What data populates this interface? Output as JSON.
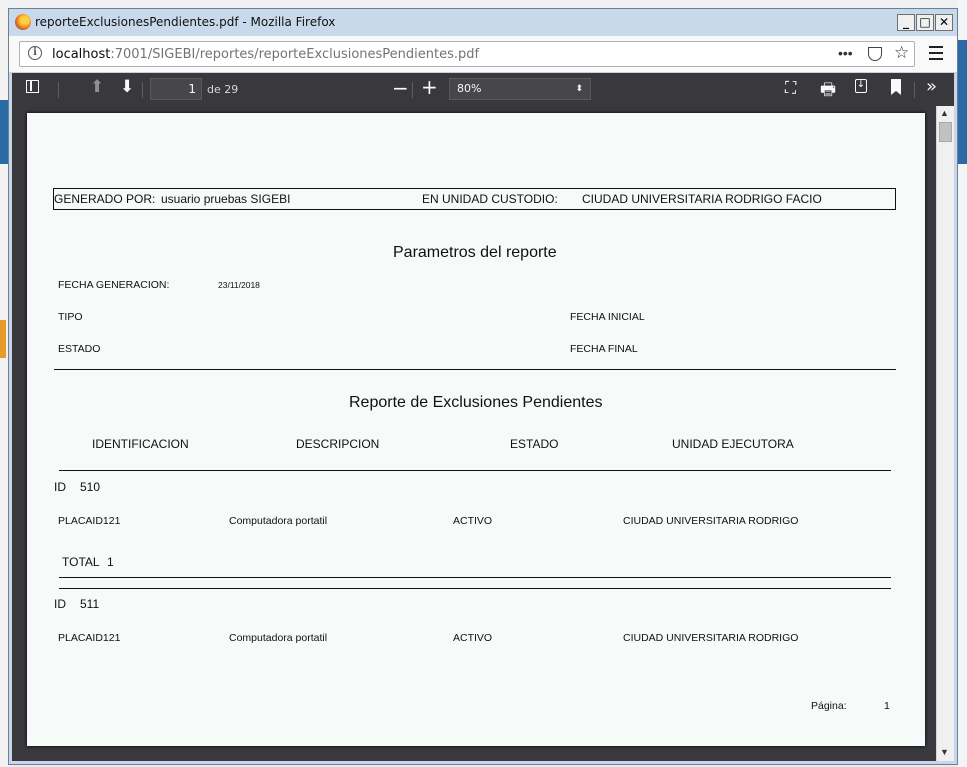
{
  "window": {
    "title": "reporteExclusionesPendientes.pdf - Mozilla Firefox",
    "minimize": "_",
    "maximize": "□",
    "close": "✕"
  },
  "navbar": {
    "url_host": "localhost",
    "url_path": ":7001/SIGEBI/reportes/reporteExclusionesPendientes.pdf",
    "more": "•••"
  },
  "pdf_toolbar": {
    "page_number": "1",
    "page_count_label": "de 29",
    "zoom": "80%"
  },
  "report": {
    "generated_by_label": "GENERADO POR:",
    "generated_by_value": "usuario pruebas SIGEBI",
    "unit_label": "EN UNIDAD CUSTODIO:",
    "unit_value": "CIUDAD UNIVERSITARIA RODRIGO FACIO",
    "params_title": "Parametros del reporte",
    "fecha_generacion_label": "FECHA GENERACION:",
    "fecha_generacion_value": "23/11/2018",
    "tipo_label": "TIPO",
    "fecha_inicial_label": "FECHA INICIAL",
    "estado_label": "ESTADO",
    "fecha_final_label": "FECHA FINAL",
    "report_title": "Reporte de Exclusiones Pendientes",
    "columns": [
      "IDENTIFICACION",
      "DESCRIPCION",
      "ESTADO",
      "UNIDAD EJECUTORA"
    ],
    "groups": [
      {
        "id_label": "ID",
        "id_value": "510",
        "row": [
          "PLACAID121",
          "Computadora portatil",
          "ACTIVO",
          "CIUDAD UNIVERSITARIA RODRIGO"
        ],
        "total_label": "TOTAL",
        "total_value": "1"
      },
      {
        "id_label": "ID",
        "id_value": "511",
        "row": [
          "PLACAID121",
          "Computadora portatil",
          "ACTIVO",
          "CIUDAD UNIVERSITARIA RODRIGO"
        ]
      }
    ],
    "page_label": "Página:",
    "page_value": "1"
  }
}
